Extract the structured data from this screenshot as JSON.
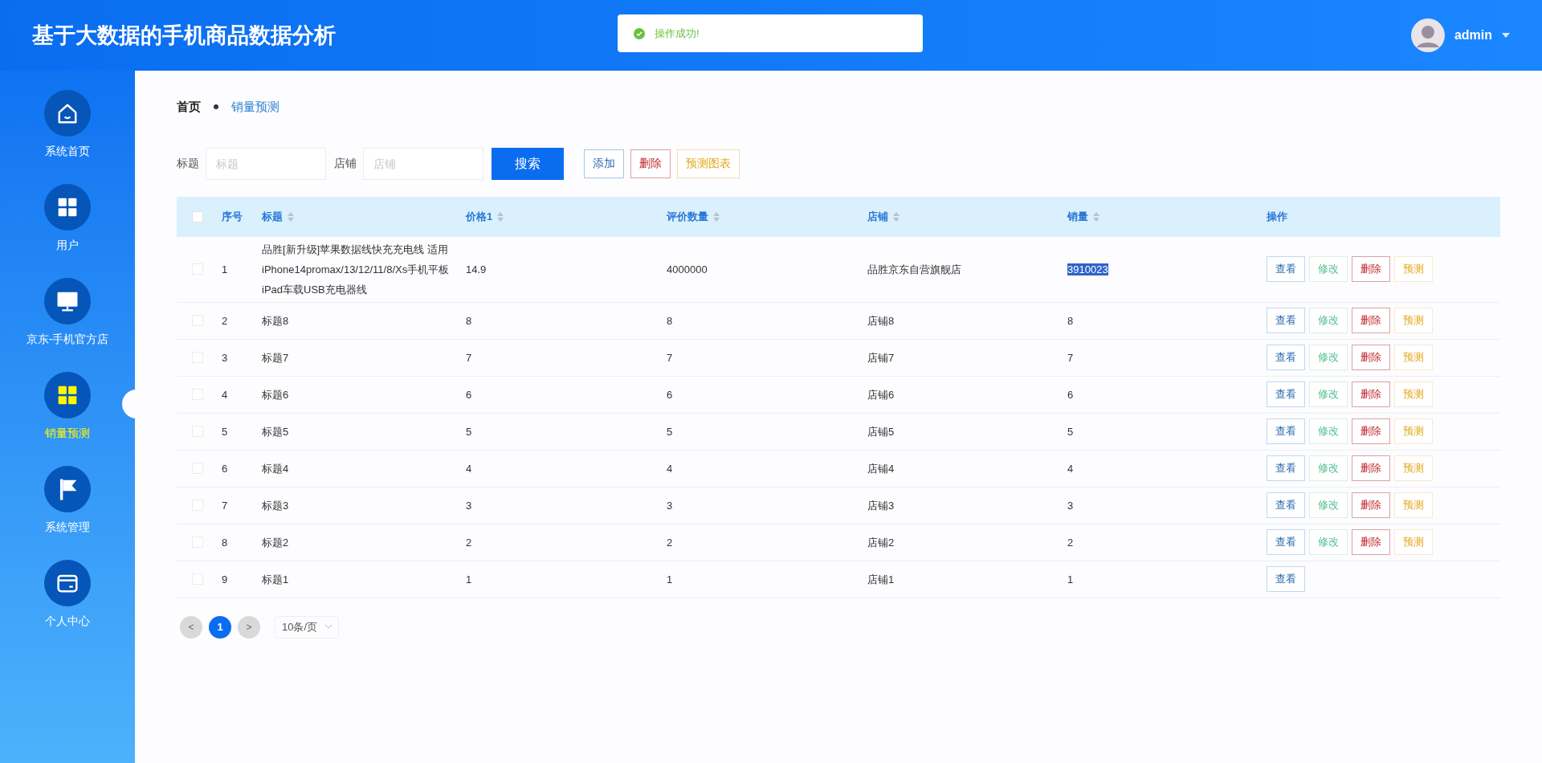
{
  "header": {
    "title": "基于大数据的手机商品数据分析",
    "user": "admin"
  },
  "toast": {
    "message": "操作成功!"
  },
  "sidebar": {
    "items": [
      {
        "label": "系统首页",
        "kind": "home",
        "selected": false
      },
      {
        "label": "用户",
        "kind": "grid",
        "selected": false
      },
      {
        "label": "京东-手机官方店",
        "kind": "monitor",
        "selected": false
      },
      {
        "label": "销量预测",
        "kind": "grid",
        "selected": true
      },
      {
        "label": "系统管理",
        "kind": "flag",
        "selected": false
      },
      {
        "label": "个人中心",
        "kind": "card",
        "selected": false
      }
    ]
  },
  "breadcrumb": [
    "首页",
    "销量预测"
  ],
  "search": {
    "fields": [
      {
        "label": "标题",
        "placeholder": "标题"
      },
      {
        "label": "店铺",
        "placeholder": "店铺"
      }
    ],
    "button": "搜索",
    "actions": [
      {
        "label": "添加",
        "kind": "add"
      },
      {
        "label": "删除",
        "kind": "delete"
      },
      {
        "label": "预测图表",
        "kind": "chart"
      }
    ]
  },
  "table": {
    "all_checked": false,
    "columns": [
      {
        "label": "序号",
        "sortable": false
      },
      {
        "label": "标题",
        "sortable": true
      },
      {
        "label": "价格1",
        "sortable": true
      },
      {
        "label": "评价数量",
        "sortable": true
      },
      {
        "label": "店铺",
        "sortable": true
      },
      {
        "label": "销量",
        "sortable": true
      },
      {
        "label": "操作",
        "sortable": false
      }
    ],
    "rows": [
      {
        "checked": false,
        "cells": [
          "1",
          "品胜[新升级]苹果数据线快充充电线 适用iPhone14promax/13/12/11/8/Xs手机平板iPad车载USB充电器线",
          "14.9",
          "4000000",
          "品胜京东自营旗舰店",
          "3910023"
        ],
        "sales_highlighted": true,
        "actions": [
          {
            "label": "查看",
            "kind": "view"
          },
          {
            "label": "修改",
            "kind": "edit"
          },
          {
            "label": "删除",
            "kind": "delete"
          },
          {
            "label": "预测",
            "kind": "predict"
          }
        ]
      },
      {
        "checked": false,
        "cells": [
          "2",
          "标题8",
          "8",
          "8",
          "店铺8",
          "8"
        ],
        "sales_highlighted": false,
        "actions": [
          {
            "label": "查看",
            "kind": "view"
          },
          {
            "label": "修改",
            "kind": "edit"
          },
          {
            "label": "删除",
            "kind": "delete"
          },
          {
            "label": "预测",
            "kind": "predict"
          }
        ]
      },
      {
        "checked": false,
        "cells": [
          "3",
          "标题7",
          "7",
          "7",
          "店铺7",
          "7"
        ],
        "sales_highlighted": false,
        "actions": [
          {
            "label": "查看",
            "kind": "view"
          },
          {
            "label": "修改",
            "kind": "edit"
          },
          {
            "label": "删除",
            "kind": "delete"
          },
          {
            "label": "预测",
            "kind": "predict"
          }
        ]
      },
      {
        "checked": false,
        "cells": [
          "4",
          "标题6",
          "6",
          "6",
          "店铺6",
          "6"
        ],
        "sales_highlighted": false,
        "actions": [
          {
            "label": "查看",
            "kind": "view"
          },
          {
            "label": "修改",
            "kind": "edit"
          },
          {
            "label": "删除",
            "kind": "delete"
          },
          {
            "label": "预测",
            "kind": "predict"
          }
        ]
      },
      {
        "checked": false,
        "cells": [
          "5",
          "标题5",
          "5",
          "5",
          "店铺5",
          "5"
        ],
        "sales_highlighted": false,
        "actions": [
          {
            "label": "查看",
            "kind": "view"
          },
          {
            "label": "修改",
            "kind": "edit"
          },
          {
            "label": "删除",
            "kind": "delete"
          },
          {
            "label": "预测",
            "kind": "predict"
          }
        ]
      },
      {
        "checked": false,
        "cells": [
          "6",
          "标题4",
          "4",
          "4",
          "店铺4",
          "4"
        ],
        "sales_highlighted": false,
        "actions": [
          {
            "label": "查看",
            "kind": "view"
          },
          {
            "label": "修改",
            "kind": "edit"
          },
          {
            "label": "删除",
            "kind": "delete"
          },
          {
            "label": "预测",
            "kind": "predict"
          }
        ]
      },
      {
        "checked": false,
        "cells": [
          "7",
          "标题3",
          "3",
          "3",
          "店铺3",
          "3"
        ],
        "sales_highlighted": false,
        "actions": [
          {
            "label": "查看",
            "kind": "view"
          },
          {
            "label": "修改",
            "kind": "edit"
          },
          {
            "label": "删除",
            "kind": "delete"
          },
          {
            "label": "预测",
            "kind": "predict"
          }
        ]
      },
      {
        "checked": false,
        "cells": [
          "8",
          "标题2",
          "2",
          "2",
          "店铺2",
          "2"
        ],
        "sales_highlighted": false,
        "actions": [
          {
            "label": "查看",
            "kind": "view"
          },
          {
            "label": "修改",
            "kind": "edit"
          },
          {
            "label": "删除",
            "kind": "delete"
          },
          {
            "label": "预测",
            "kind": "predict"
          }
        ]
      },
      {
        "checked": false,
        "cells": [
          "9",
          "标题1",
          "1",
          "1",
          "店铺1",
          "1"
        ],
        "sales_highlighted": false,
        "actions": [
          {
            "label": "查看",
            "kind": "view"
          }
        ]
      }
    ]
  },
  "pagination": {
    "prev": "<",
    "pages": [
      {
        "label": "1",
        "selected": true
      }
    ],
    "next": ">",
    "page_size": "10条/页"
  }
}
